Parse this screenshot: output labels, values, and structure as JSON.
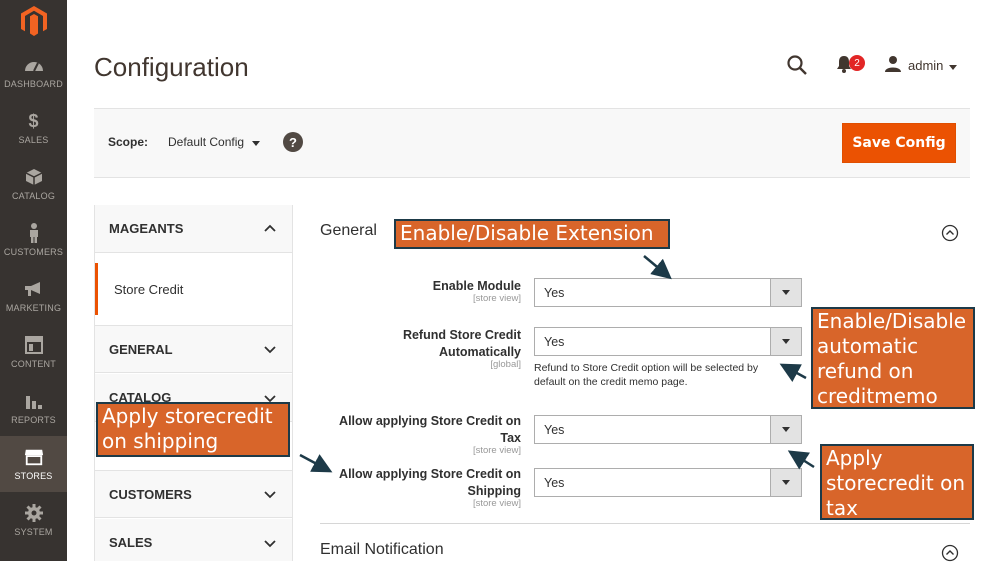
{
  "nav": {
    "items": [
      {
        "label": "DASHBOARD",
        "icon": "gauge-icon"
      },
      {
        "label": "SALES",
        "icon": "dollar-icon"
      },
      {
        "label": "CATALOG",
        "icon": "cube-icon"
      },
      {
        "label": "CUSTOMERS",
        "icon": "person-icon"
      },
      {
        "label": "MARKETING",
        "icon": "megaphone-icon"
      },
      {
        "label": "CONTENT",
        "icon": "layout-icon"
      },
      {
        "label": "REPORTS",
        "icon": "bar-chart-icon"
      },
      {
        "label": "STORES",
        "icon": "store-icon"
      },
      {
        "label": "SYSTEM",
        "icon": "gear-icon"
      }
    ]
  },
  "header": {
    "title": "Configuration",
    "notifications_count": "2",
    "user": "admin"
  },
  "scope": {
    "label": "Scope:",
    "value": "Default Config",
    "help": "?"
  },
  "actions": {
    "save": "Save Config"
  },
  "tabs": {
    "mageants": "MAGEANTS",
    "store_credit": "Store Credit",
    "general": "GENERAL",
    "catalog": "CATALOG",
    "customers": "CUSTOMERS",
    "sales": "SALES"
  },
  "sections": {
    "general": {
      "title": "General",
      "fields": [
        {
          "label": "Enable Module",
          "scope": "[store view]",
          "value": "Yes"
        },
        {
          "label": "Refund Store Credit Automatically",
          "scope": "[global]",
          "value": "Yes",
          "note": "Refund to Store Credit option will be selected by default on the credit memo page."
        },
        {
          "label": "Allow applying Store Credit on Tax",
          "scope": "[store view]",
          "value": "Yes"
        },
        {
          "label": "Allow applying Store Credit on Shipping",
          "scope": "[store view]",
          "value": "Yes"
        }
      ]
    },
    "email": {
      "title": "Email Notification"
    }
  },
  "annotations": {
    "enable_extension": "Enable/Disable Extension",
    "auto_refund": "Enable/Disable automatic refund on creditmemo",
    "shipping": "Apply storecredit on shipping",
    "tax": "Apply storecredit on tax"
  },
  "colors": {
    "nav_bg": "#373330",
    "accent": "#eb5202",
    "callout_bg": "#d8652a",
    "callout_border": "#1d3a48"
  }
}
